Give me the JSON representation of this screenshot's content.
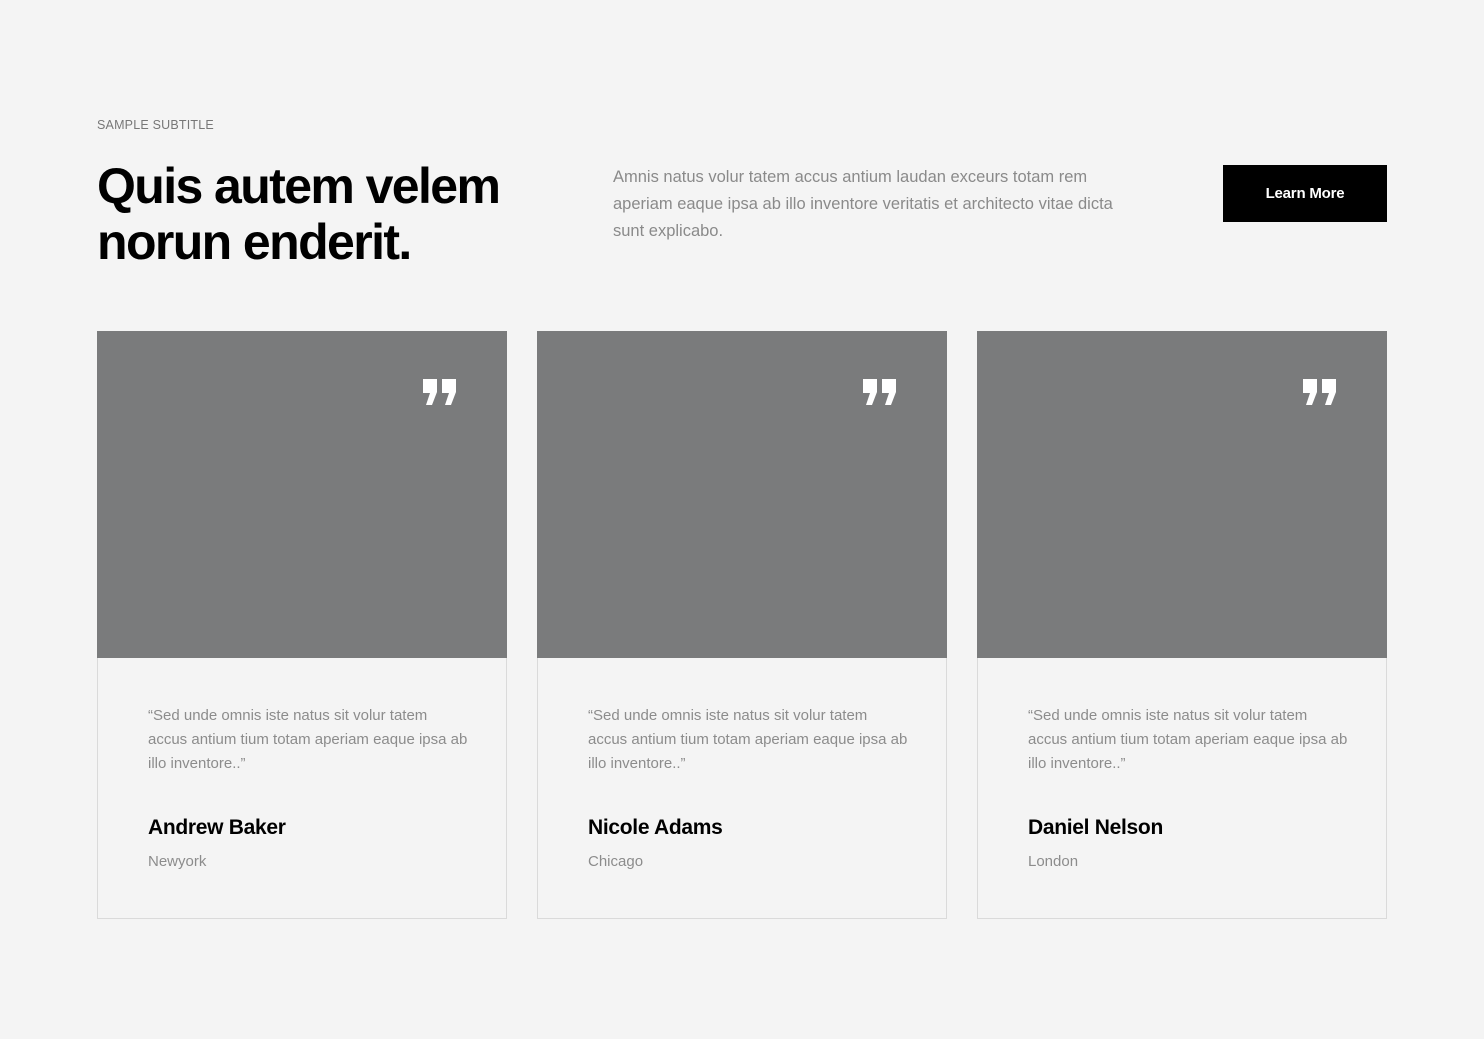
{
  "header": {
    "subtitle": "SAMPLE SUBTITLE",
    "title": "Quis autem velem norun enderit.",
    "intro": "Amnis natus volur tatem accus antium laudan exceurs totam rem aperiam eaque ipsa ab illo inventore veritatis et architecto vitae dicta sunt explicabo.",
    "button_label": "Learn More"
  },
  "testimonials": [
    {
      "quote": "“Sed unde omnis iste natus sit volur tatem accus antium tium totam aperiam eaque ipsa ab illo inventore..”",
      "name": "Andrew Baker",
      "city": "Newyork"
    },
    {
      "quote": "“Sed unde omnis iste natus sit volur tatem accus antium tium totam aperiam eaque ipsa ab illo inventore..”",
      "name": "Nicole Adams",
      "city": "Chicago"
    },
    {
      "quote": "“Sed unde omnis iste natus sit volur tatem accus antium tium totam aperiam eaque ipsa ab illo inventore..”",
      "name": "Daniel Nelson",
      "city": "London"
    }
  ],
  "icons": {
    "quote": "quote-icon"
  },
  "colors": {
    "background": "#f4f4f4",
    "image_placeholder": "#7a7b7c",
    "button": "#000000",
    "muted_text": "#8c8c8c"
  }
}
